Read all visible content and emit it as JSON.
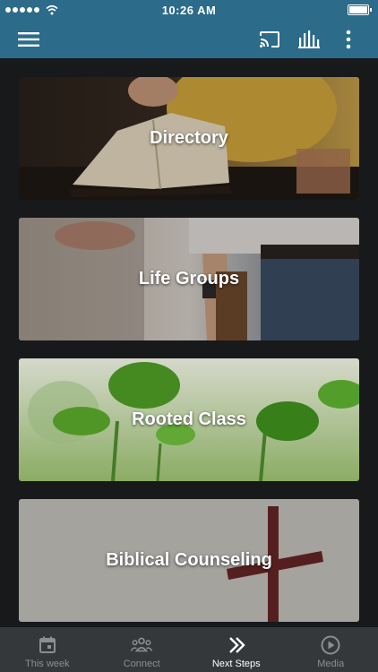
{
  "status_bar": {
    "time": "10:26 AM"
  },
  "app_bar": {
    "menu_icon": "hamburger-menu-icon",
    "cast_icon": "cast-icon",
    "bars_icon": "audio-bars-icon",
    "more_icon": "more-vertical-icon"
  },
  "cards": [
    {
      "label": "Directory",
      "image": "person-reading-bible"
    },
    {
      "label": "Life Groups",
      "image": "people-with-bible"
    },
    {
      "label": "Rooted Class",
      "image": "green-seedlings"
    },
    {
      "label": "Biblical Counseling",
      "image": "wooden-cross"
    }
  ],
  "tabs": [
    {
      "label": "This week",
      "icon": "calendar-icon",
      "active": false
    },
    {
      "label": "Connect",
      "icon": "people-group-icon",
      "active": false
    },
    {
      "label": "Next Steps",
      "icon": "double-chevron-right-icon",
      "active": true
    },
    {
      "label": "Media",
      "icon": "play-circle-icon",
      "active": false
    }
  ],
  "colors": {
    "header": "#2c6b8a",
    "background": "#17191b",
    "tab_bar": "#34383b",
    "tab_active": "#ffffff",
    "tab_inactive": "#8b8f92"
  }
}
